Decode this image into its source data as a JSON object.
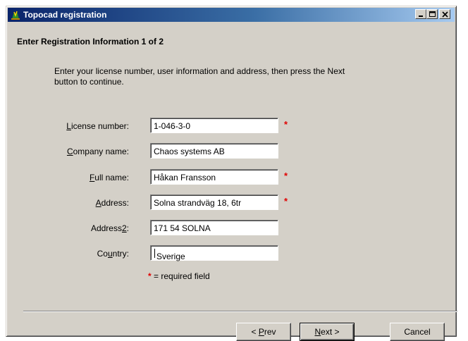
{
  "window": {
    "title": "Topocad registration",
    "controls": [
      "minimize-icon",
      "maximize-icon",
      "close-icon"
    ]
  },
  "header": {
    "heading": "Enter Registration Information 1 of 2"
  },
  "intro": {
    "line1": "Enter your license number, user information and address, then press the Next",
    "line2": "button to continue."
  },
  "form": {
    "license": {
      "label_mnemonic": "L",
      "label_rest": "icense number:",
      "value": "1-046-3-0",
      "required": true
    },
    "company": {
      "label_mnemonic": "C",
      "label_rest": "ompany name:",
      "value": "Chaos systems AB",
      "required": false
    },
    "fullname": {
      "label_mnemonic": "F",
      "label_rest": "ull name:",
      "value": "Håkan Fransson",
      "required": true
    },
    "address": {
      "label_pre": "",
      "label_mnemonic": "A",
      "label_rest": "ddress:",
      "value": "Solna strandväg 18, 6tr",
      "required": true
    },
    "address2": {
      "label_pre": "Address",
      "label_mnemonic": "2",
      "label_rest": ":",
      "value": "171 54  SOLNA",
      "required": false
    },
    "country": {
      "label_pre": "Co",
      "label_mnemonic": "u",
      "label_rest": "ntry:",
      "value": "Sverige",
      "required": false
    },
    "required_marker": "*",
    "legend_text": " = required field"
  },
  "buttons": {
    "prev": {
      "pre": "< ",
      "mnemonic": "P",
      "rest": "rev"
    },
    "next": {
      "pre": "",
      "mnemonic": "N",
      "rest": "ext >"
    },
    "cancel": {
      "label": "Cancel"
    }
  },
  "colors": {
    "title_gradient_start": "#0a246a",
    "title_gradient_end": "#a6caf0",
    "dialog_face": "#d4d0c8",
    "required_marker": "#e00000"
  }
}
